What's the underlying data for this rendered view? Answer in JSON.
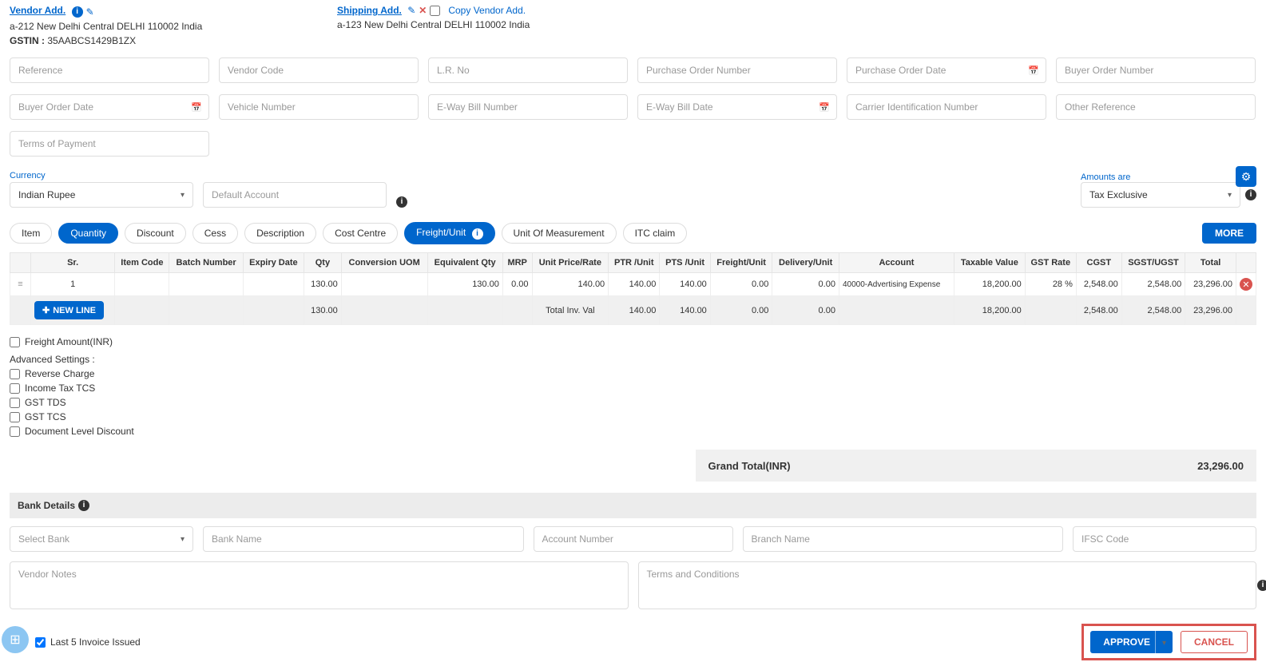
{
  "vendor": {
    "title": "Vendor Add.",
    "address": "a-212 New Delhi Central DELHI 110002 India",
    "gstin_label": "GSTIN :",
    "gstin": "35AABCS1429B1ZX"
  },
  "shipping": {
    "title": "Shipping Add.",
    "copy_label": "Copy Vendor Add.",
    "address": "a-123 New Delhi Central DELHI 110002 India"
  },
  "fields": {
    "reference": "Reference",
    "vendor_code": "Vendor Code",
    "lr_no": "L.R. No",
    "po_number": "Purchase Order Number",
    "po_date": "Purchase Order Date",
    "buyer_order_number": "Buyer Order Number",
    "buyer_order_date": "Buyer Order Date",
    "vehicle_number": "Vehicle Number",
    "eway_bill_number": "E-Way Bill Number",
    "eway_bill_date": "E-Way Bill Date",
    "carrier_id": "Carrier Identification Number",
    "other_reference": "Other Reference",
    "terms_of_payment": "Terms of Payment"
  },
  "currency": {
    "label": "Currency",
    "value": "Indian Rupee",
    "default_account": "Default Account"
  },
  "amounts": {
    "label": "Amounts are",
    "value": "Tax Exclusive"
  },
  "pills": {
    "item": "Item",
    "quantity": "Quantity",
    "discount": "Discount",
    "cess": "Cess",
    "description": "Description",
    "cost_centre": "Cost Centre",
    "freight_unit": "Freight/Unit",
    "uom": "Unit Of Measurement",
    "itc": "ITC claim",
    "more": "MORE"
  },
  "table": {
    "headers": {
      "sr": "Sr.",
      "item_code": "Item Code",
      "batch": "Batch Number",
      "expiry": "Expiry Date",
      "qty": "Qty",
      "conv_uom": "Conversion UOM",
      "eq_qty": "Equivalent Qty",
      "mrp": "MRP",
      "unit_price": "Unit Price/Rate",
      "ptr": "PTR /Unit",
      "pts": "PTS /Unit",
      "freight": "Freight/Unit",
      "delivery": "Delivery/Unit",
      "account": "Account",
      "taxable": "Taxable Value",
      "gst_rate": "GST Rate",
      "cgst": "CGST",
      "sgst": "SGST/UGST",
      "total": "Total"
    },
    "row": {
      "sr": "1",
      "qty": "130.00",
      "eq_qty": "130.00",
      "mrp": "0.00",
      "unit_price": "140.00",
      "ptr": "140.00",
      "pts": "140.00",
      "freight": "0.00",
      "delivery": "0.00",
      "account": "40000-Advertising Expense",
      "taxable": "18,200.00",
      "gst_rate": "28 %",
      "cgst": "2,548.00",
      "sgst": "2,548.00",
      "total": "23,296.00"
    },
    "totals": {
      "label": "Total Inv. Val",
      "qty": "130.00",
      "ptr": "140.00",
      "pts": "140.00",
      "freight": "0.00",
      "delivery": "0.00",
      "taxable": "18,200.00",
      "cgst": "2,548.00",
      "sgst": "2,548.00",
      "total": "23,296.00"
    },
    "new_line": "NEW LINE"
  },
  "checks": {
    "freight_amount": "Freight Amount(INR)",
    "adv_title": "Advanced Settings :",
    "reverse_charge": "Reverse Charge",
    "income_tax_tcs": "Income Tax TCS",
    "gst_tds": "GST TDS",
    "gst_tcs": "GST TCS",
    "doc_discount": "Document Level Discount"
  },
  "grand_total": {
    "label": "Grand Total(INR)",
    "value": "23,296.00"
  },
  "bank": {
    "title": "Bank Details",
    "select_bank": "Select Bank",
    "bank_name": "Bank Name",
    "account_number": "Account Number",
    "branch_name": "Branch Name",
    "ifsc": "IFSC Code"
  },
  "notes": {
    "vendor_notes": "Vendor Notes",
    "terms": "Terms and Conditions"
  },
  "footer": {
    "last5": "Last 5 Invoice Issued",
    "approve": "APPROVE",
    "cancel": "CANCEL"
  }
}
